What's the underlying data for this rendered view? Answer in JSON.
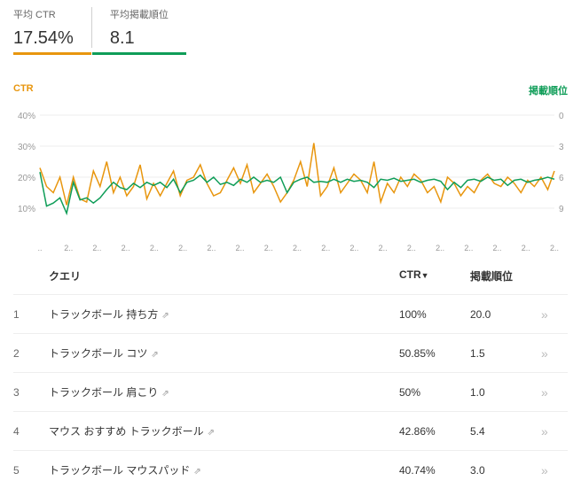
{
  "metrics": {
    "ctr_label": "平均 CTR",
    "ctr_value": "17.54%",
    "pos_label": "平均掲載順位",
    "pos_value": "8.1"
  },
  "legend": {
    "ctr": "CTR",
    "pos": "掲載順位"
  },
  "chart_data": {
    "type": "line",
    "xlabel": "",
    "ylabel_left": "CTR",
    "ylabel_right": "掲載順位",
    "ylim_left": [
      0,
      40
    ],
    "ylim_right": [
      0,
      9
    ],
    "yticks_left": [
      "40%",
      "30%",
      "20%",
      "10%"
    ],
    "yticks_right": [
      "0",
      "3",
      "6",
      "9"
    ],
    "x_labels": [
      "..",
      "2..",
      "2..",
      "2..",
      "2..",
      "2..",
      "2..",
      "2..",
      "2..",
      "2..",
      "2..",
      "2..",
      "2..",
      "2..",
      "2..",
      "2..",
      "2..",
      "2..",
      "2.."
    ],
    "series": [
      {
        "name": "CTR",
        "color": "#e8960e",
        "values": [
          23,
          17,
          15,
          20,
          11,
          20,
          13,
          12,
          22,
          17,
          25,
          15,
          20,
          14,
          17,
          24,
          13,
          18,
          14,
          18,
          22,
          14,
          19,
          20,
          24,
          18,
          14,
          15,
          19,
          23,
          18,
          24,
          15,
          18,
          21,
          17,
          12,
          15,
          19,
          25,
          17,
          31,
          14,
          17,
          23,
          15,
          18,
          21,
          19,
          15,
          25,
          12,
          18,
          15,
          20,
          17,
          21,
          19,
          15,
          17,
          12,
          20,
          18,
          14,
          17,
          15,
          19,
          21,
          18,
          17,
          20,
          18,
          15,
          19,
          17,
          20,
          16,
          22
        ]
      },
      {
        "name": "掲載順位",
        "color": "#0f9d58",
        "values": [
          5.5,
          8.8,
          8.5,
          8.0,
          9.5,
          6.5,
          8.2,
          8.0,
          8.5,
          8.0,
          7.2,
          6.5,
          7.0,
          7.2,
          6.6,
          7.0,
          6.5,
          6.8,
          6.5,
          7.0,
          6.2,
          7.5,
          6.5,
          6.3,
          5.8,
          6.5,
          6.0,
          6.7,
          6.5,
          6.8,
          6.2,
          6.5,
          6.0,
          6.5,
          6.3,
          6.5,
          6.0,
          7.5,
          6.5,
          6.2,
          6.0,
          6.5,
          6.4,
          6.5,
          6.2,
          6.5,
          6.2,
          6.4,
          6.3,
          6.5,
          7.0,
          6.2,
          6.3,
          6.1,
          6.4,
          6.3,
          6.2,
          6.5,
          6.3,
          6.2,
          6.4,
          7.2,
          6.5,
          7.0,
          6.3,
          6.2,
          6.4,
          6.0,
          6.3,
          6.2,
          6.8,
          6.3,
          6.2,
          6.5,
          6.3,
          6.2,
          6.0,
          6.2
        ]
      }
    ]
  },
  "table": {
    "headers": {
      "query": "クエリ",
      "ctr": "CTR",
      "sort": "▼",
      "pos": "掲載順位"
    },
    "rows": [
      {
        "rank": "1",
        "query": "トラックボール 持ち方",
        "ctr": "100%",
        "pos": "20.0"
      },
      {
        "rank": "2",
        "query": "トラックボール コツ",
        "ctr": "50.85%",
        "pos": "1.5"
      },
      {
        "rank": "3",
        "query": "トラックボール 肩こり",
        "ctr": "50%",
        "pos": "1.0"
      },
      {
        "rank": "4",
        "query": "マウス おすすめ トラックボール",
        "ctr": "42.86%",
        "pos": "5.4"
      },
      {
        "rank": "5",
        "query": "トラックボール マウスパッド",
        "ctr": "40.74%",
        "pos": "3.0"
      }
    ]
  },
  "icons": {
    "external": "⇗",
    "arrow": "»"
  }
}
